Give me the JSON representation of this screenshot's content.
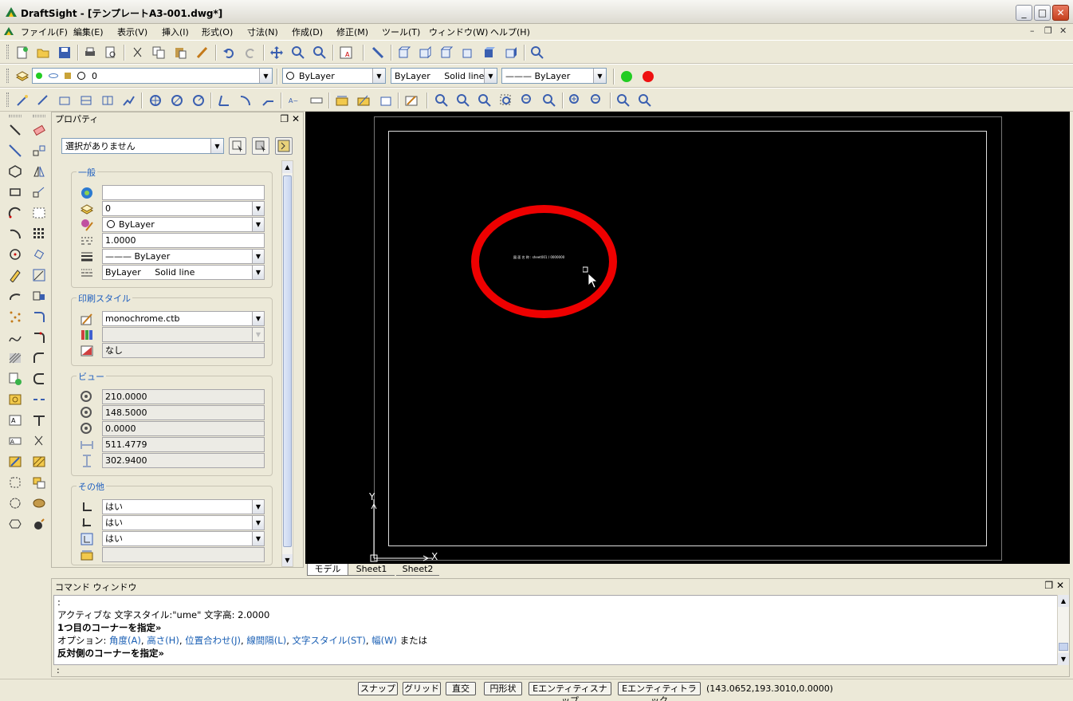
{
  "window": {
    "app_name": "DraftSight",
    "title": "DraftSight - [テンプレートA3-001.dwg*]",
    "minimize": "_",
    "maximize": "□",
    "close": "✕"
  },
  "menu": {
    "items": [
      "ファイル(F)",
      "編集(E)",
      "表示(V)",
      "挿入(I)",
      "形式(O)",
      "寸法(N)",
      "作成(D)",
      "修正(M)",
      "ツール(T)",
      "ウィンドウ(W)",
      "ヘルプ(H)"
    ],
    "mdi_minimize": "–",
    "mdi_restore": "❐",
    "mdi_close": "✕"
  },
  "layer_toolbar": {
    "layer_value": "0",
    "color_value": "ByLayer",
    "linestyle_value": "ByLayer     Solid line",
    "lineweight_value": "——— ByLayer",
    "status_colors": [
      "#22cc22",
      "#ee1111"
    ]
  },
  "properties": {
    "title": "プロパティ",
    "selection": "選択がありません",
    "groups": {
      "general": {
        "title": "一般",
        "rows": [
          {
            "icon": "color-wheel-icon",
            "value": ""
          },
          {
            "icon": "layer-icon",
            "value": "0"
          },
          {
            "icon": "color-icon",
            "value": "ByLayer"
          },
          {
            "icon": "linescale-icon",
            "value": "1.0000"
          },
          {
            "icon": "lineweight-icon",
            "value": "——— ByLayer"
          },
          {
            "icon": "linestyle-icon",
            "value": "ByLayer     Solid line"
          }
        ]
      },
      "print_style": {
        "title": "印刷スタイル",
        "rows": [
          {
            "icon": "print-style-icon",
            "value": "monochrome.ctb"
          },
          {
            "icon": "print-color-icon",
            "value": ""
          },
          {
            "icon": "print-table-icon",
            "value": "なし"
          }
        ]
      },
      "view": {
        "title": "ビュー",
        "rows": [
          {
            "icon": "center-x-icon",
            "value": "210.0000"
          },
          {
            "icon": "center-y-icon",
            "value": "148.5000"
          },
          {
            "icon": "center-z-icon",
            "value": "0.0000"
          },
          {
            "icon": "width-icon",
            "value": "511.4779"
          },
          {
            "icon": "height-icon",
            "value": "302.9400"
          }
        ]
      },
      "other": {
        "title": "その他",
        "rows": [
          {
            "icon": "ucs-icon",
            "value": "はい"
          },
          {
            "icon": "ucs-origin-icon",
            "value": "はい"
          },
          {
            "icon": "ucs-viewport-icon",
            "value": "はい"
          },
          {
            "icon": "ucs-name-icon",
            "value": ""
          }
        ]
      }
    }
  },
  "drawing": {
    "annotation_text": "図 面 名 称 : sheet001 / 0000000",
    "ucs_y_label": "Y",
    "ucs_x_label": "X"
  },
  "tabs": [
    "モデル",
    "Sheet1",
    "Sheet2"
  ],
  "command_window": {
    "title": "コマンド ウィンドウ",
    "lines": [
      {
        "text": ":",
        "style": "normal"
      },
      {
        "text": "アクティブな 文字スタイル:\"ume\" 文字高: 2.0000",
        "style": "normal"
      },
      {
        "text": "1つ目のコーナーを指定»",
        "style": "bold"
      }
    ],
    "options_prefix": "オプション: ",
    "options": [
      "角度(A)",
      "高さ(H)",
      "位置合わせ(J)",
      "線間隔(L)",
      "文字スタイル(ST)",
      "幅(W)"
    ],
    "options_suffix": "または",
    "last_line": "反対側のコーナーを指定»",
    "input_prompt": ":"
  },
  "status_bar": {
    "buttons": [
      "スナップ",
      "グリッド",
      "直交",
      "円形状",
      "Eエンティティスナップ",
      "Eエンティティトラック"
    ],
    "coordinates": "(143.0652,193.3010,0.0000)"
  }
}
